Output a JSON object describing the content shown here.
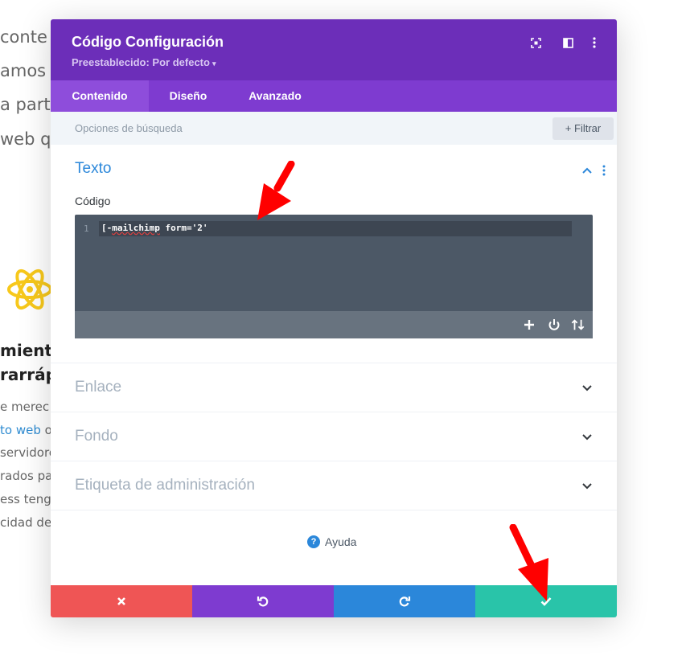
{
  "background": {
    "lines": [
      " conte",
      "amos",
      "a parti",
      "web q"
    ],
    "heading": [
      "mient",
      "rarráp"
    ],
    "paragraph": [
      "e merec",
      "to web",
      " o",
      "servidore",
      "rados pa",
      "ess teng",
      "cidad de"
    ]
  },
  "modal": {
    "title": "Código Configuración",
    "preset": "Preestablecido: Por defecto",
    "tabs": [
      {
        "label": "Contenido",
        "active": true
      },
      {
        "label": "Diseño",
        "active": false
      },
      {
        "label": "Avanzado",
        "active": false
      }
    ],
    "search_placeholder": "Opciones de búsqueda",
    "filter_label": "Filtrar",
    "sections": {
      "text": {
        "title": "Texto",
        "field_label": "Código"
      },
      "link": {
        "title": "Enlace"
      },
      "background": {
        "title": "Fondo"
      },
      "admin_label": {
        "title": "Etiqueta de administración"
      }
    },
    "editor": {
      "line_number": "1",
      "code_prefix": "[-",
      "code_misspelled": "mailchimp",
      "code_suffix": " form='2'"
    },
    "help_label": "Ayuda"
  },
  "colors": {
    "header": "#6c2eb9",
    "tabs": "#7e3bd0",
    "cancel": "#ef5555",
    "undo": "#7e3bd0",
    "redo": "#2b87da",
    "save": "#29c4a9",
    "accent": "#2b87da",
    "arrow": "#ff0000"
  }
}
